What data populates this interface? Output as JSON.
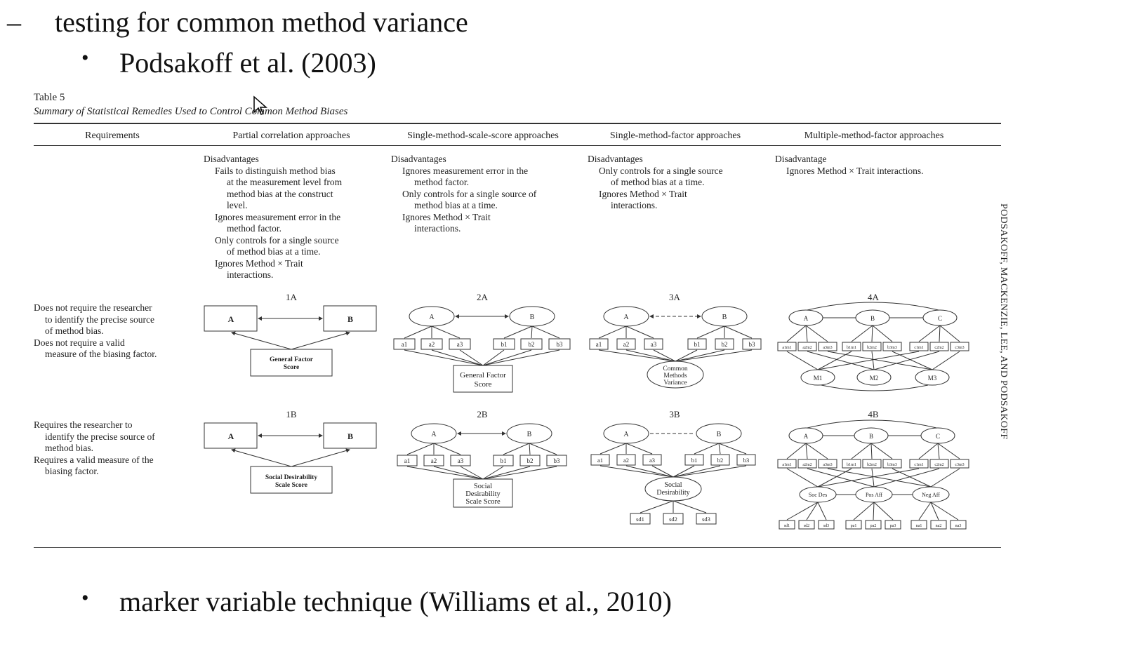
{
  "slide": {
    "dash": "–",
    "line1": "testing for common method variance",
    "bullet_symbol": "•",
    "line2": "Podsakoff et al. (2003)",
    "line3": "marker variable technique (Williams et al., 2010)"
  },
  "table": {
    "number": "Table 5",
    "title": "Summary of Statistical Remedies Used to Control Common Method Biases",
    "headers": [
      "Requirements",
      "Partial correlation approaches",
      "Single-method-scale-score approaches",
      "Single-method-factor approaches",
      "Multiple-method-factor approaches"
    ],
    "disadvantages": {
      "partial": {
        "heading": "Disadvantages",
        "items": [
          [
            "Fails to distinguish method bias",
            "at the measurement level from",
            "method bias at the construct",
            "level."
          ],
          [
            "Ignores measurement error in the",
            "method factor."
          ],
          [
            "Only controls for a single source",
            "of method bias at a time."
          ],
          [
            "Ignores Method × Trait",
            "interactions."
          ]
        ]
      },
      "single_scale": {
        "heading": "Disadvantages",
        "items": [
          [
            "Ignores measurement error in the",
            "method factor."
          ],
          [
            "Only controls for a single source of",
            "method bias at a time."
          ],
          [
            "Ignores Method × Trait",
            "interactions."
          ]
        ]
      },
      "single_factor": {
        "heading": "Disadvantages",
        "items": [
          [
            "Only controls for a single source",
            "of method bias at a time."
          ],
          [
            "Ignores Method × Trait",
            "interactions."
          ]
        ]
      },
      "multiple_factor": {
        "heading": "Disadvantage",
        "items": [
          [
            "Ignores Method × Trait interactions."
          ]
        ]
      }
    },
    "req_row1": [
      [
        "Does not require the researcher",
        "to identify the precise source",
        "of method bias."
      ],
      [
        "Does not require a valid",
        "measure of the biasing factor."
      ]
    ],
    "req_row2": [
      [
        "Requires the researcher to",
        "identify the precise source of",
        "method bias."
      ],
      [
        "Requires a valid measure of the",
        "biasing factor."
      ]
    ],
    "diagram_labels": {
      "d1a": "1A",
      "d2a": "2A",
      "d3a": "3A",
      "d4a": "4A",
      "d1b": "1B",
      "d2b": "2B",
      "d3b": "3B",
      "d4b": "4B"
    },
    "diagram_text": {
      "A": "A",
      "B": "B",
      "C": "C",
      "general_factor": [
        "General Factor",
        "Score"
      ],
      "social_desirability": [
        "Social Desirability",
        "Scale Score"
      ],
      "social_desirability_3": [
        "Social",
        "Desirability",
        "Scale Score"
      ],
      "common_methods": [
        "Common",
        "Methods",
        "Variance"
      ],
      "social_des_factor": [
        "Social",
        "Desirability"
      ],
      "indicators_a": [
        "a1",
        "a2",
        "a3"
      ],
      "indicators_b": [
        "b1",
        "b2",
        "b3"
      ],
      "sd_items": [
        "sd1",
        "sd2",
        "sd3"
      ],
      "methods": [
        "M1",
        "M2",
        "M3"
      ],
      "methods_4b": [
        "Soc Des",
        "Pos Aff",
        "Neg Aff"
      ],
      "mtmm_indicators": [
        "a1m1",
        "a2m2",
        "a3m3",
        "b1m1",
        "b2m2",
        "b3m3",
        "c1m1",
        "c2m2",
        "c3m3"
      ],
      "method_items": [
        "sd1",
        "sd2",
        "sd3",
        "pa1",
        "pa2",
        "pa3",
        "na1",
        "na2",
        "na3"
      ]
    },
    "side_text": "PODSAKOFF, MACKENZIE, LEE, AND PODSAKOFF"
  }
}
